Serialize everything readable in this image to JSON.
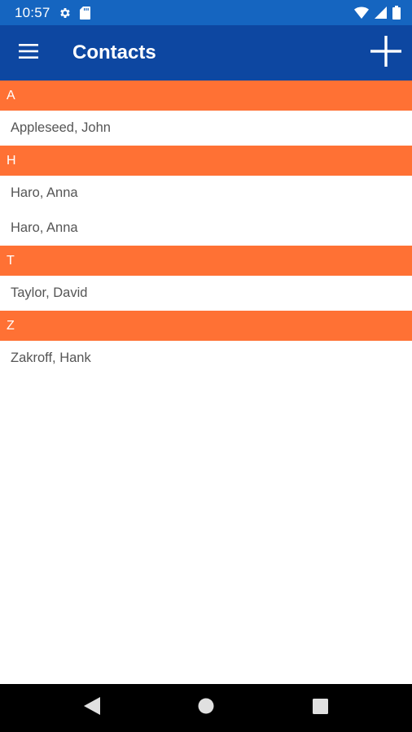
{
  "status_bar": {
    "time": "10:57",
    "icons": [
      "gear-icon",
      "sd-card-icon",
      "wifi-icon",
      "signal-icon",
      "battery-icon"
    ]
  },
  "app_bar": {
    "title": "Contacts",
    "menu_icon": "hamburger-menu-icon",
    "add_icon": "plus-icon"
  },
  "colors": {
    "status_bar": "#1565c0",
    "app_bar": "#0d47a1",
    "section_header": "#ff7134",
    "nav_bar": "#000000"
  },
  "sections": [
    {
      "letter": "A",
      "contacts": [
        "Appleseed, John"
      ]
    },
    {
      "letter": "H",
      "contacts": [
        "Haro, Anna",
        "Haro, Anna"
      ]
    },
    {
      "letter": "T",
      "contacts": [
        "Taylor, David"
      ]
    },
    {
      "letter": "Z",
      "contacts": [
        "Zakroff, Hank"
      ]
    }
  ],
  "nav_bar": {
    "icons": [
      "back-icon",
      "home-icon",
      "recents-icon"
    ]
  }
}
